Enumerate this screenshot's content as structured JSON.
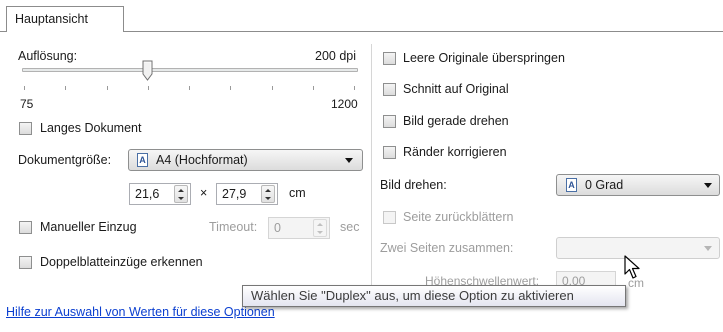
{
  "tabs": {
    "main_label": "Hauptansicht"
  },
  "resolution": {
    "label": "Auflösung:",
    "value_text": "200 dpi",
    "min_label": "75",
    "max_label": "1200",
    "value": 200,
    "min": 75,
    "max": 1200
  },
  "long_document": {
    "label": "Langes Dokument",
    "checked": false
  },
  "document_size": {
    "label": "Dokumentgröße:",
    "icon_glyph": "A",
    "value": "A4 (Hochformat)",
    "width": "21,6",
    "times": "×",
    "height": "27,9",
    "unit": "cm"
  },
  "manual_feed": {
    "label": "Manueller Einzug",
    "checked": false,
    "timeout_label": "Timeout:",
    "timeout_value": "0",
    "timeout_unit": "sec"
  },
  "double_feed": {
    "label": "Doppelblatteinzüge erkennen",
    "checked": false
  },
  "right": {
    "skip_blank": "Leere Originale überspringen",
    "crop_to_original": "Schnitt auf Original",
    "deskew": "Bild gerade drehen",
    "edge_fix": "Ränder korrigieren",
    "rotate_label": "Bild drehen:",
    "rotate_icon_glyph": "A",
    "rotate_value": "0 Grad",
    "page_back": "Seite zurückblättern",
    "merge_label": "Zwei Seiten zusammen:",
    "merge_value": "",
    "height_label_partial": "Höhenschwellenwert:",
    "height_value_partial": "0,00",
    "height_unit_partial": "cm"
  },
  "help_link": "Hilfe zur Auswahl von Werten für diese Optionen",
  "tooltip": "Wählen Sie \"Duplex\" aus, um diese Option zu aktivieren",
  "colors": {
    "link": "#0b3fd0",
    "disabled_text": "#9d9d9d",
    "border": "#8c8c8c"
  }
}
